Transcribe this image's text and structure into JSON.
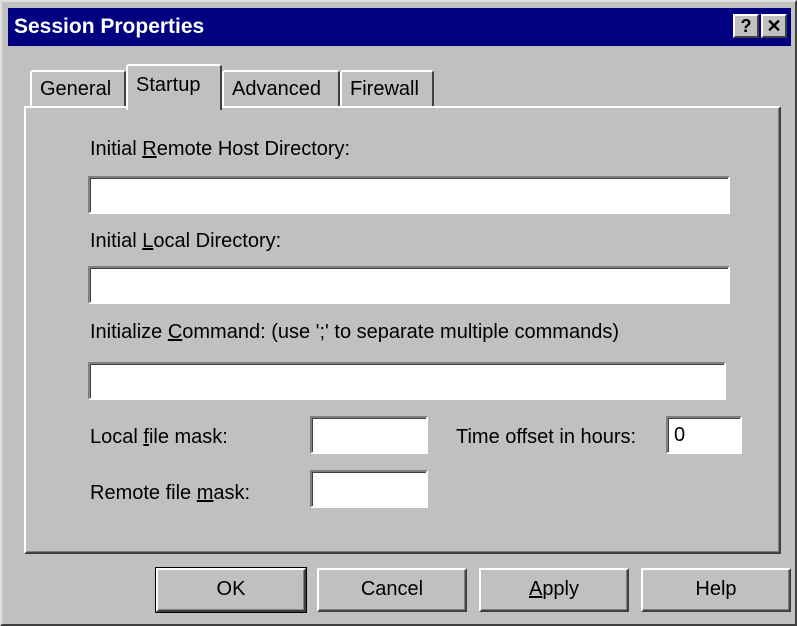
{
  "window": {
    "title": "Session Properties",
    "help_glyph": "?",
    "close_glyph": "✕"
  },
  "tabs": [
    {
      "label": "General",
      "active": false
    },
    {
      "label": "Startup",
      "active": true
    },
    {
      "label": "Advanced",
      "active": false
    },
    {
      "label": "Firewall",
      "active": false
    }
  ],
  "form": {
    "remote_dir_label_pre": "Initial ",
    "remote_dir_label_key": "R",
    "remote_dir_label_post": "emote Host Directory:",
    "remote_dir_value": "",
    "local_dir_label_pre": "Initial ",
    "local_dir_label_key": "L",
    "local_dir_label_post": "ocal Directory:",
    "local_dir_value": "",
    "init_cmd_label_pre": "Initialize ",
    "init_cmd_label_key": "C",
    "init_cmd_label_post": "ommand: (use ';' to separate multiple commands)",
    "init_cmd_value": "",
    "local_mask_label_pre": "Local ",
    "local_mask_label_key": "f",
    "local_mask_label_post": "ile mask:",
    "local_mask_value": "",
    "remote_mask_label_pre": "Remote file ",
    "remote_mask_label_key": "m",
    "remote_mask_label_post": "ask:",
    "remote_mask_value": "",
    "time_offset_label": "Time offset in hours:",
    "time_offset_value": "0"
  },
  "buttons": {
    "ok": "OK",
    "cancel": "Cancel",
    "apply_key": "A",
    "apply_rest": "pply",
    "help": "Help"
  }
}
